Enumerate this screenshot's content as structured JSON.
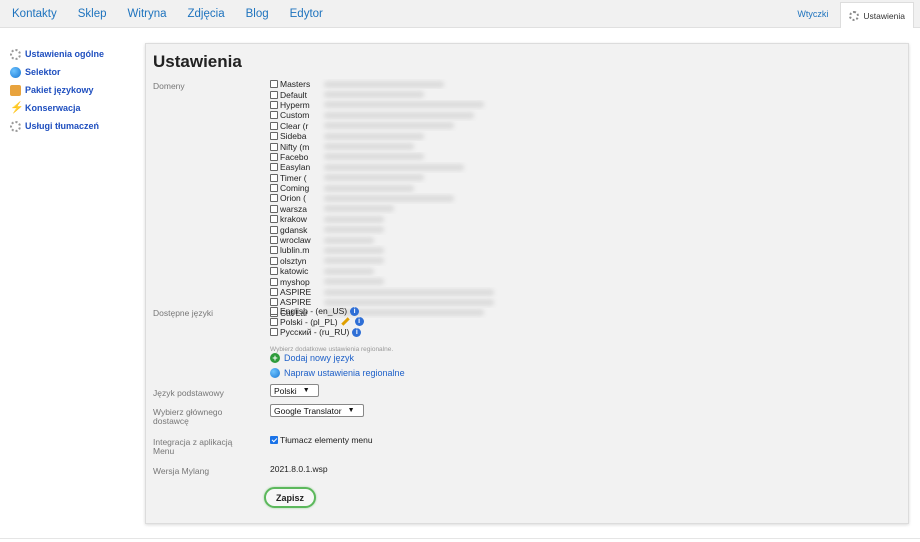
{
  "topnav": [
    "Kontakty",
    "Sklep",
    "Witryna",
    "Zdjęcia",
    "Blog",
    "Edytor"
  ],
  "topright": {
    "plugins": "Wtyczki",
    "settings": "Ustawienia"
  },
  "sidebar": [
    {
      "label": "Ustawienia ogólne",
      "icon": "gear-icon"
    },
    {
      "label": "Selektor",
      "icon": "globe-icon"
    },
    {
      "label": "Pakiet językowy",
      "icon": "package-icon"
    },
    {
      "label": "Konserwacja",
      "icon": "bolt-icon"
    },
    {
      "label": "Usługi tłumaczeń",
      "icon": "gear-icon"
    }
  ],
  "panel": {
    "title": "Ustawienia",
    "domains_label": "Domeny",
    "domains": [
      "Masters",
      "Default",
      "Hyperm",
      "Custom",
      "Clear (r",
      "Sideba",
      "Nifty (m",
      "Facebo",
      "Easylan",
      "Timer (",
      "Coming",
      "Orion (",
      "warsza",
      "krakow",
      "gdansk",
      "wroclaw",
      "lublin.m",
      "olsztyn",
      "katowic",
      "myshop",
      "ASPIRE",
      "ASPIRE",
      "Cat Lar"
    ],
    "languages_label": "Dostępne języki",
    "languages": [
      "English - (en_US)",
      "Polski - (pl_PL)",
      "Русский - (ru_RU)"
    ],
    "hint": "Wybierz dodatkowe ustawienia regionalne.",
    "add_language": "Dodaj nowy język",
    "fix_regional": "Napraw ustawienia regionalne",
    "base_language_label": "Język podstawowy",
    "base_language_value": "Polski",
    "provider_label": "Wybierz głównego dostawcę",
    "provider_value": "Google Translator",
    "integration_label": "Integracja z aplikacją Menu",
    "integration_option": "Tłumacz elementy menu",
    "version_label": "Wersja Mylang",
    "version_value": "2021.8.0.1.wsp",
    "save": "Zapisz"
  }
}
